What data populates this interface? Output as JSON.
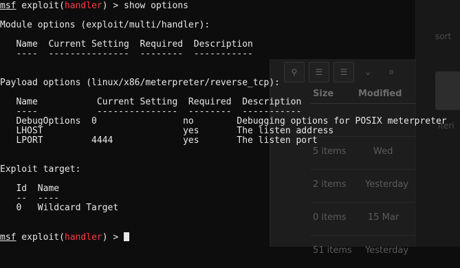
{
  "background": {
    "file_manager": {
      "toolbar_icons": [
        "search-icon",
        "list-view-icon",
        "list-view-icon",
        "chevron-down-icon",
        "close-icon"
      ],
      "columns": [
        "Size",
        "Modified"
      ],
      "rows": [
        {
          "size": "",
          "modified": ""
        },
        {
          "size": "5 items",
          "modified": "Wed"
        },
        {
          "size": "2 items",
          "modified": "Yesterday"
        },
        {
          "size": "0 items",
          "modified": "15 Mar"
        },
        {
          "size": "51 items",
          "modified": "Yesterday"
        }
      ]
    },
    "right_panel": {
      "label_top": "sort",
      "label_mid": "iteri"
    }
  },
  "terminal": {
    "prompt": {
      "msf": "msf",
      "module_prefix": " exploit(",
      "module_name": "handler",
      "module_suffix": ") > "
    },
    "command": "show options",
    "module_options_title": "Module options (exploit/multi/handler):",
    "module_header": "   Name  Current Setting  Required  Description",
    "module_divider": "   ----  ---------------  --------  -----------",
    "payload_options_title": "Payload options (linux/x86/meterpreter/reverse_tcp):",
    "payload_header": "   Name           Current Setting  Required  Description",
    "payload_divider": "   ----           ---------------  --------  -----------",
    "payload_rows": [
      "   DebugOptions  0                no        Debugging options for POSIX meterpreter",
      "   LHOST                          yes       The listen address",
      "   LPORT         4444             yes       The listen port"
    ],
    "exploit_target_title": "Exploit target:",
    "target_header": "   Id  Name",
    "target_divider": "   --  ----",
    "target_row": "   0   Wildcard Target"
  }
}
